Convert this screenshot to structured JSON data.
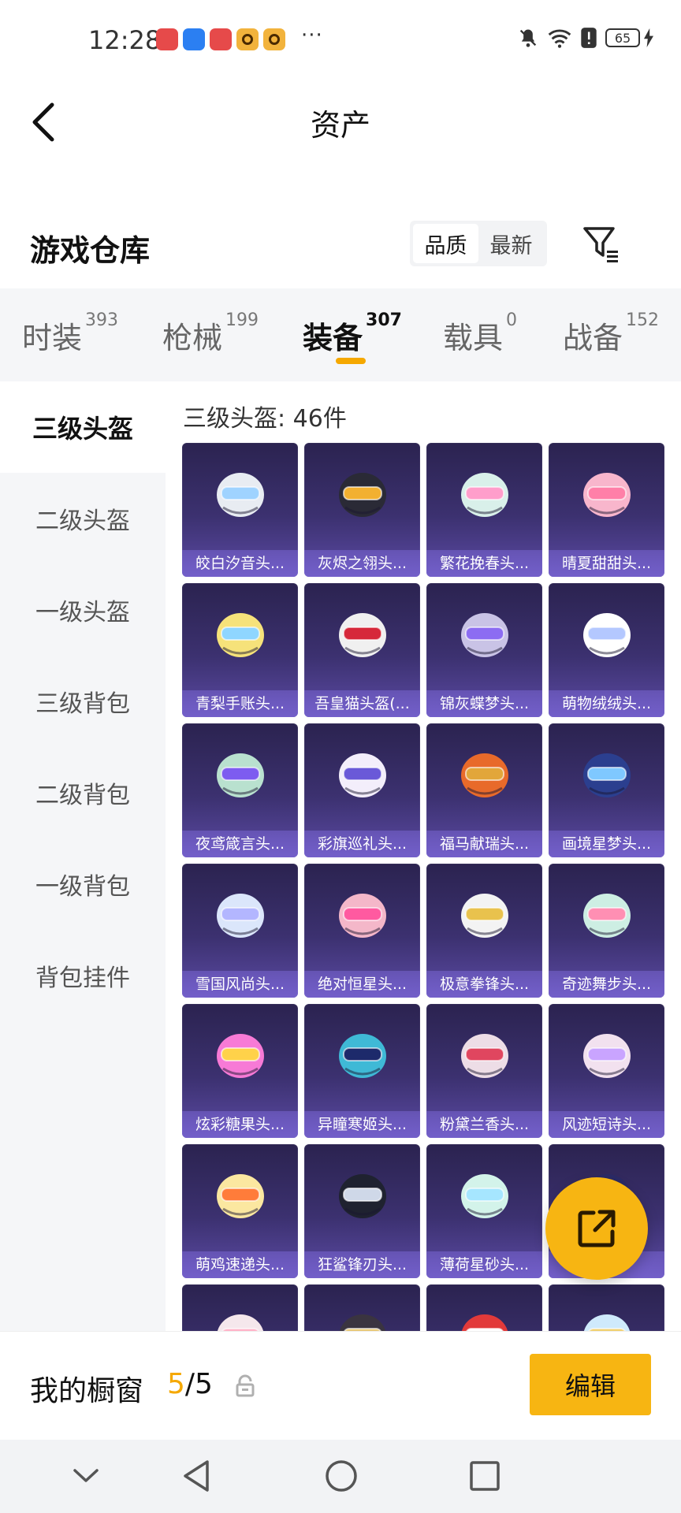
{
  "status_bar": {
    "time": "12:28",
    "more": "···",
    "battery": "65"
  },
  "header": {
    "title": "资产"
  },
  "warehouse": {
    "title": "游戏仓库",
    "sort_options": [
      "品质",
      "最新"
    ],
    "active_sort": "品质"
  },
  "tabs": [
    {
      "label": "时装",
      "count": "393"
    },
    {
      "label": "枪械",
      "count": "199"
    },
    {
      "label": "装备",
      "count": "307"
    },
    {
      "label": "载具",
      "count": "0"
    },
    {
      "label": "战备",
      "count": "152"
    }
  ],
  "active_tab": "装备",
  "sidebar": {
    "items": [
      "三级头盔",
      "二级头盔",
      "一级头盔",
      "三级背包",
      "二级背包",
      "一级背包",
      "背包挂件"
    ],
    "active": "三级头盔"
  },
  "section_title": "三级头盔: 46件",
  "items": [
    {
      "name": "皎白汐音头...",
      "color": "#e8ecf2",
      "visor": "#9fd3ff"
    },
    {
      "name": "灰烬之翎头...",
      "color": "#2a2a36",
      "visor": "#f2b030"
    },
    {
      "name": "繁花挽春头...",
      "color": "#d9f0ea",
      "visor": "#ff9ecb"
    },
    {
      "name": "晴夏甜甜头...",
      "color": "#f8b6cc",
      "visor": "#ff7fa8"
    },
    {
      "name": "青梨手账头...",
      "color": "#f6e27a",
      "visor": "#8fd6ff"
    },
    {
      "name": "吾皇猫头盔(...",
      "color": "#f0f0f0",
      "visor": "#d6283a"
    },
    {
      "name": "锦灰蝶梦头...",
      "color": "#c9c3e6",
      "visor": "#8c6cf2"
    },
    {
      "name": "萌物绒绒头...",
      "color": "#ffffff",
      "visor": "#b4c8ff"
    },
    {
      "name": "夜鸢箴言头...",
      "color": "#b9e1cf",
      "visor": "#7d5cf0"
    },
    {
      "name": "彩旗巡礼头...",
      "color": "#f3eefb",
      "visor": "#6a59d8"
    },
    {
      "name": "福马献瑞头...",
      "color": "#e86a2a",
      "visor": "#e2a63a"
    },
    {
      "name": "画境星梦头...",
      "color": "#2b3f8f",
      "visor": "#7fc8ff"
    },
    {
      "name": "雪国风尚头...",
      "color": "#dbe6fb",
      "visor": "#b3b6ff"
    },
    {
      "name": "绝对恒星头...",
      "color": "#f4b7c9",
      "visor": "#ff5aa0"
    },
    {
      "name": "极意拳锋头...",
      "color": "#f3f3f3",
      "visor": "#e9c24d"
    },
    {
      "name": "奇迹舞步头...",
      "color": "#cdeee3",
      "visor": "#ff8fb3"
    },
    {
      "name": "炫彩糖果头...",
      "color": "#f77ad6",
      "visor": "#ffd24a"
    },
    {
      "name": "异瞳寒姬头...",
      "color": "#3fb9d6",
      "visor": "#1d2a6b"
    },
    {
      "name": "粉黛兰香头...",
      "color": "#eddde6",
      "visor": "#e0465f"
    },
    {
      "name": "风迹短诗头...",
      "color": "#f2e1ef",
      "visor": "#c9a4ff"
    },
    {
      "name": "萌鸡速递头...",
      "color": "#fbe7a0",
      "visor": "#ff7c3a"
    },
    {
      "name": "狂鲨锋刃头...",
      "color": "#1f2230",
      "visor": "#cfd8e8"
    },
    {
      "name": "薄荷星砂头...",
      "color": "#d3f3ea",
      "visor": "#a6e6ff"
    },
    {
      "name": "",
      "color": "#2b2a66",
      "visor": "#9bb0ff"
    },
    {
      "name": "",
      "color": "#f5e7ec",
      "visor": "#ffb3c8"
    },
    {
      "name": "",
      "color": "#3a3440",
      "visor": "#e8c878"
    },
    {
      "name": "",
      "color": "#e23a3a",
      "visor": "#ffffff"
    },
    {
      "name": "",
      "color": "#cfeafc",
      "visor": "#f0d070"
    }
  ],
  "showcase": {
    "label": "我的橱窗",
    "current": "5",
    "total": "/5",
    "edit_label": "编辑"
  },
  "colors": {
    "accent": "#f7b512",
    "tab_underline": "#f5a800",
    "card_top": "#2b2350",
    "card_bottom": "#5b4aa4"
  },
  "icons": [
    "back-arrow-icon",
    "filter-icon",
    "share-icon",
    "lock-icon",
    "nav-down-icon",
    "nav-back-icon",
    "nav-home-icon",
    "nav-recents-icon"
  ]
}
